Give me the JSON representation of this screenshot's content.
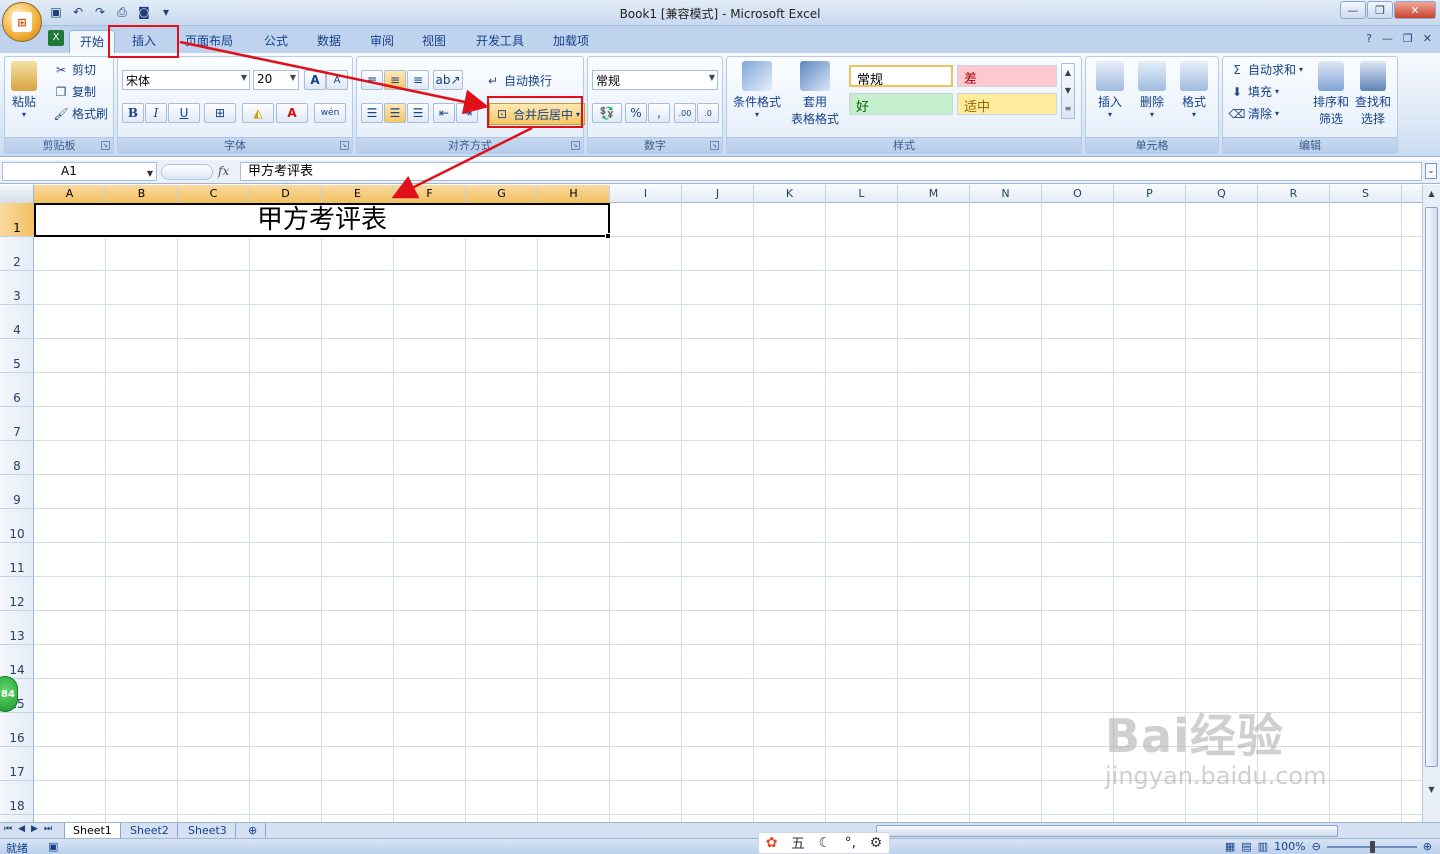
{
  "window": {
    "title": "Book1  [兼容模式] - Microsoft Excel",
    "buttons": [
      "minimize-icon",
      "restore-icon",
      "close-icon"
    ]
  },
  "qat": [
    "save-icon",
    "undo-icon",
    "redo-icon",
    "print-preview-icon",
    "camera-icon",
    "customize-icon"
  ],
  "tabs": [
    {
      "label": "开始",
      "active": true
    },
    {
      "label": "插入",
      "active": false
    },
    {
      "label": "页面布局",
      "active": false
    },
    {
      "label": "公式",
      "active": false
    },
    {
      "label": "数据",
      "active": false
    },
    {
      "label": "审阅",
      "active": false
    },
    {
      "label": "视图",
      "active": false
    },
    {
      "label": "开发工具",
      "active": false
    },
    {
      "label": "加载项",
      "active": false
    }
  ],
  "ribbon": {
    "clipboard": {
      "label": "剪贴板",
      "paste": "粘贴",
      "cut": "剪切",
      "copy": "复制",
      "format_painter": "格式刷"
    },
    "font": {
      "label": "字体",
      "name": "宋体",
      "size": "20",
      "bold": "B",
      "italic": "I",
      "underline": "U",
      "grow": "A",
      "shrink": "A",
      "font_color": "A",
      "phonetic": "wén"
    },
    "alignment": {
      "label": "对齐方式",
      "wrap_text": "自动换行",
      "merge_center": "合并后居中"
    },
    "number": {
      "label": "数字",
      "format": "常规",
      "percent": "%",
      "comma": ",",
      "inc_decimal": ".00",
      "dec_decimal": ".0"
    },
    "styles": {
      "label": "样式",
      "cond_format": "条件格式",
      "table_format_1": "套用",
      "table_format_2": "表格格式",
      "normal": "常规",
      "bad": "差",
      "good": "好",
      "neutral": "适中"
    },
    "cells": {
      "label": "单元格",
      "insert": "插入",
      "delete": "删除",
      "format": "格式"
    },
    "editing": {
      "label": "编辑",
      "autosum": "自动求和",
      "fill": "填充",
      "clear": "清除",
      "sort_1": "排序和",
      "sort_2": "筛选",
      "find_1": "查找和",
      "find_2": "选择"
    }
  },
  "formula_bar": {
    "name_box": "A1",
    "fx": "fx",
    "content": "甲方考评表"
  },
  "columns": [
    "A",
    "B",
    "C",
    "D",
    "E",
    "F",
    "G",
    "H",
    "I",
    "J",
    "K",
    "L",
    "M",
    "N",
    "O",
    "P",
    "Q",
    "R",
    "S"
  ],
  "rows": [
    "1",
    "2",
    "3",
    "4",
    "5",
    "6",
    "7",
    "8",
    "9",
    "10",
    "11",
    "12",
    "13",
    "14",
    "15",
    "16",
    "17",
    "18"
  ],
  "cell_a1": "甲方考评表",
  "sheets": [
    "Sheet1",
    "Sheet2",
    "Sheet3"
  ],
  "status": {
    "ready": "就绪",
    "zoom": "100%"
  },
  "ime": {
    "mode": "五"
  },
  "badge": "84",
  "watermark": {
    "brand": "Bai经验",
    "url": "jingyan.baidu.com"
  },
  "colors": {
    "highlight": "#e0101a",
    "accent": "#15428b",
    "selected_header": "#f1c15f"
  }
}
